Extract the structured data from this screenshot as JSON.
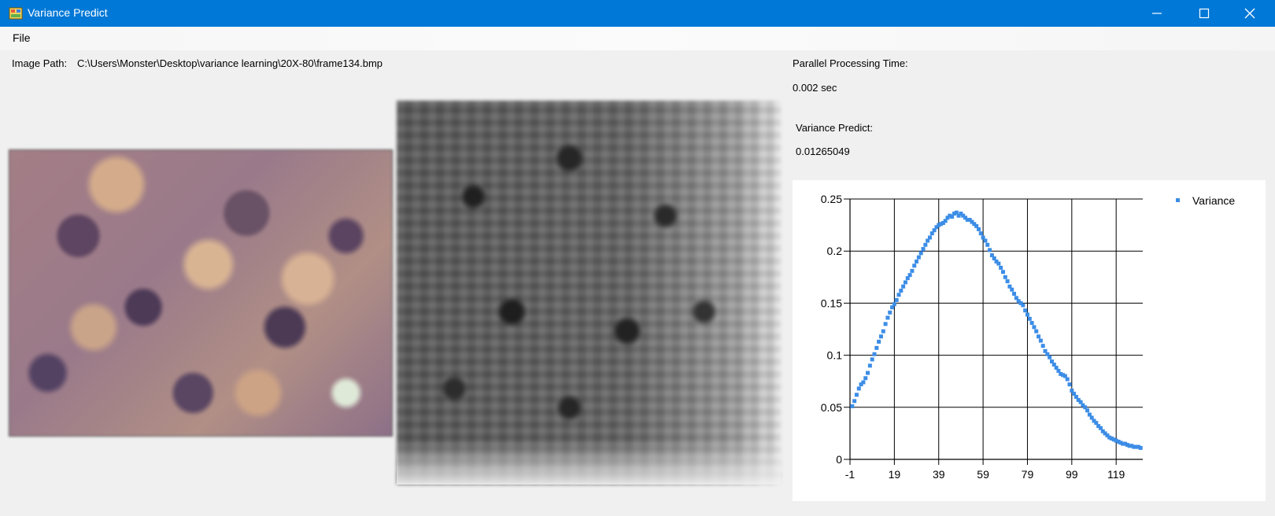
{
  "window": {
    "title": "Variance Predict"
  },
  "menu": {
    "file_label": "File"
  },
  "image_path": {
    "label": "Image Path:",
    "value": "C:\\Users\\Monster\\Desktop\\variance learning\\20X-80\\frame134.bmp"
  },
  "parallel_processing": {
    "label": "Parallel Processing Time:",
    "value": "0.002 sec"
  },
  "variance_predict": {
    "label": "Variance Predict:",
    "value": "0.01265049"
  },
  "colors": {
    "titlebar": "#0078d7",
    "series": "#3c8de6",
    "grid": "#000000"
  },
  "chart_data": {
    "type": "scatter",
    "title": "",
    "xlabel": "",
    "ylabel": "",
    "xlim": [
      -1,
      131
    ],
    "ylim": [
      0,
      0.25
    ],
    "x_ticks": [
      "-1",
      "19",
      "39",
      "59",
      "79",
      "99",
      "119"
    ],
    "y_ticks": [
      "0",
      "0.05",
      "0.1",
      "0.15",
      "0.2",
      "0.25"
    ],
    "grid": true,
    "legend_position": "top-right",
    "series": [
      {
        "name": "Variance",
        "x": [
          0,
          1,
          2,
          3,
          4,
          5,
          6,
          7,
          8,
          9,
          10,
          11,
          12,
          13,
          14,
          15,
          16,
          17,
          18,
          19,
          20,
          21,
          22,
          23,
          24,
          25,
          26,
          27,
          28,
          29,
          30,
          31,
          32,
          33,
          34,
          35,
          36,
          37,
          38,
          39,
          40,
          41,
          42,
          43,
          44,
          45,
          46,
          47,
          48,
          49,
          50,
          51,
          52,
          53,
          54,
          55,
          56,
          57,
          58,
          59,
          60,
          61,
          62,
          63,
          64,
          65,
          66,
          67,
          68,
          69,
          70,
          71,
          72,
          73,
          74,
          75,
          76,
          77,
          78,
          79,
          80,
          81,
          82,
          83,
          84,
          85,
          86,
          87,
          88,
          89,
          90,
          91,
          92,
          93,
          94,
          95,
          96,
          97,
          98,
          99,
          100,
          101,
          102,
          103,
          104,
          105,
          106,
          107,
          108,
          109,
          110,
          111,
          112,
          113,
          114,
          115,
          116,
          117,
          118,
          119,
          120,
          121,
          122,
          123,
          124,
          125,
          126,
          127,
          128,
          129,
          130
        ],
        "y": [
          0.051,
          0.056,
          0.062,
          0.068,
          0.072,
          0.074,
          0.078,
          0.083,
          0.09,
          0.096,
          0.101,
          0.107,
          0.113,
          0.118,
          0.123,
          0.13,
          0.136,
          0.141,
          0.146,
          0.149,
          0.153,
          0.158,
          0.162,
          0.166,
          0.17,
          0.174,
          0.177,
          0.181,
          0.186,
          0.19,
          0.194,
          0.198,
          0.202,
          0.206,
          0.21,
          0.213,
          0.217,
          0.22,
          0.223,
          0.225,
          0.226,
          0.227,
          0.229,
          0.232,
          0.234,
          0.233,
          0.236,
          0.237,
          0.234,
          0.236,
          0.234,
          0.232,
          0.23,
          0.23,
          0.228,
          0.226,
          0.224,
          0.221,
          0.217,
          0.213,
          0.21,
          0.206,
          0.201,
          0.196,
          0.193,
          0.19,
          0.188,
          0.184,
          0.18,
          0.175,
          0.171,
          0.166,
          0.163,
          0.159,
          0.155,
          0.152,
          0.15,
          0.148,
          0.143,
          0.139,
          0.135,
          0.131,
          0.127,
          0.123,
          0.118,
          0.114,
          0.109,
          0.104,
          0.101,
          0.098,
          0.094,
          0.091,
          0.088,
          0.085,
          0.082,
          0.081,
          0.08,
          0.077,
          0.072,
          0.066,
          0.063,
          0.06,
          0.057,
          0.055,
          0.052,
          0.05,
          0.047,
          0.043,
          0.04,
          0.037,
          0.035,
          0.032,
          0.03,
          0.027,
          0.025,
          0.023,
          0.021,
          0.02,
          0.019,
          0.018,
          0.017,
          0.016,
          0.015,
          0.015,
          0.014,
          0.013,
          0.013,
          0.012,
          0.012,
          0.012,
          0.011
        ]
      }
    ]
  }
}
